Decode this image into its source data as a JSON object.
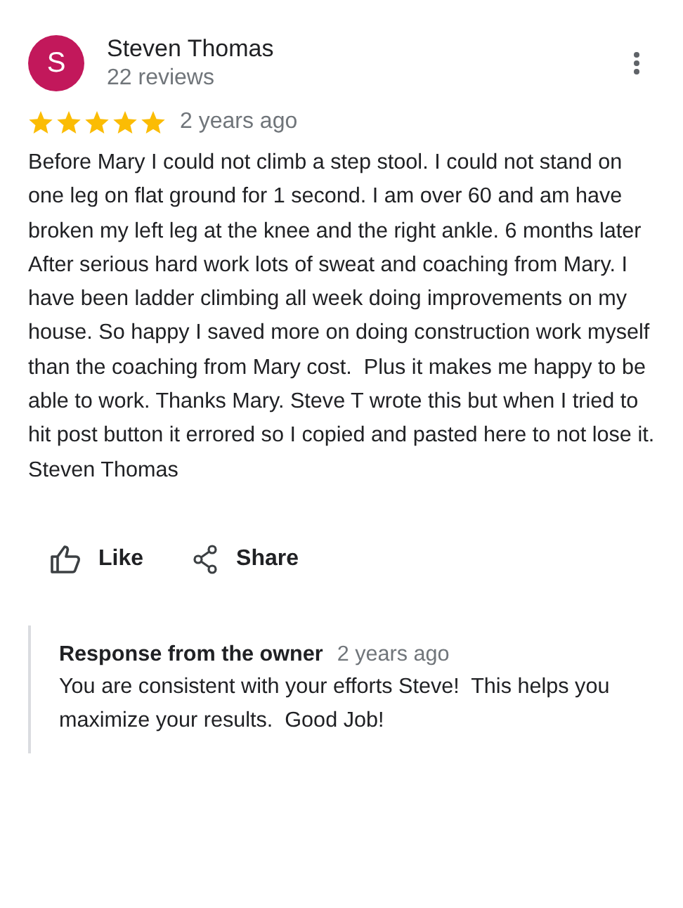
{
  "reviewer": {
    "initial": "S",
    "name": "Steven Thomas",
    "reviews": "22 reviews"
  },
  "rating": {
    "stars": 5,
    "time": "2 years ago"
  },
  "text": "Before Mary I could not climb a step stool. I could not stand on one leg on flat ground for 1 second. I am over 60 and am have broken my left leg at the knee and the right ankle. 6 months later After serious hard work lots of sweat and coaching from Mary. I have been ladder climbing all week doing improvements on my house. So happy I saved more on doing construction work myself than the coaching from Mary cost.  Plus it makes me happy to be able to work. Thanks Mary. Steve T wrote this but when I tried to hit post button it errored so I copied and pasted here to not lose it.\nSteven Thomas",
  "actions": [
    {
      "kind": "like",
      "label": "Like"
    },
    {
      "kind": "share",
      "label": "Share"
    }
  ],
  "response": {
    "title": "Response from the owner",
    "time": "2 years ago",
    "text": "You are consistent with your efforts Steve!  This helps you maximize your results.  Good Job!"
  }
}
